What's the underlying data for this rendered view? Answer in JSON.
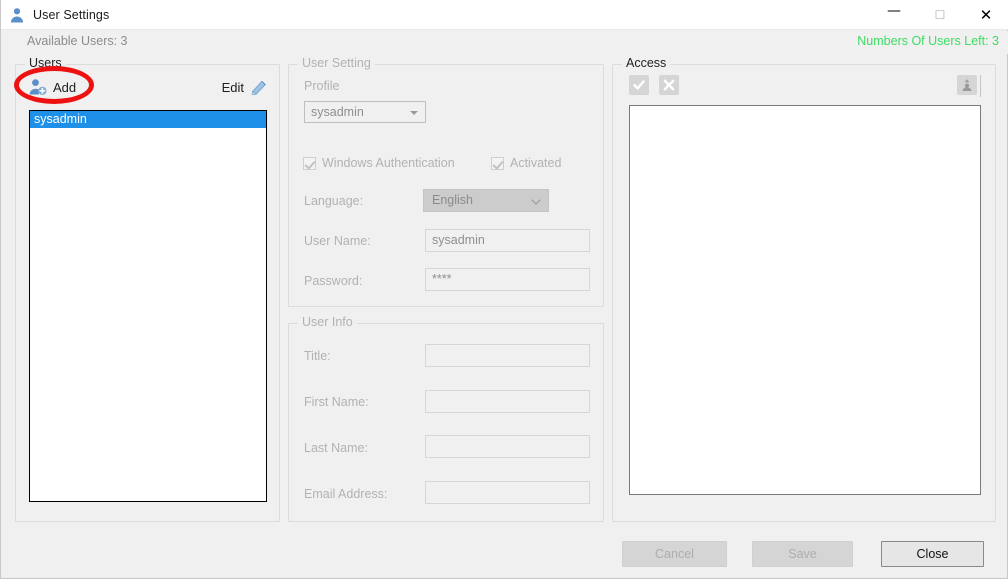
{
  "window": {
    "title": "User Settings",
    "icon": "user-icon",
    "controls": {
      "minimize": "—",
      "maximize": "☐",
      "close": "✕"
    }
  },
  "status": {
    "available_users": "Available Users: 3",
    "users_left": "Numbers Of Users Left: 3",
    "users_left_color": "#3ddc62"
  },
  "users_panel": {
    "title": "Users",
    "add_label": "Add",
    "add_icon": "add-user-icon",
    "edit_label": "Edit",
    "edit_icon": "edit-pencil-icon",
    "list": [
      {
        "label": "sysadmin",
        "selected": true
      }
    ],
    "selection_color": "#1e90e8",
    "annotation": "red-ellipse-highlight"
  },
  "user_setting": {
    "title": "User Setting",
    "profile_label": "Profile",
    "profile_value": "sysadmin",
    "windows_auth_label": "Windows Authentication",
    "windows_auth_checked": true,
    "activated_label": "Activated",
    "activated_checked": true,
    "language_label": "Language:",
    "language_value": "English",
    "username_label": "User Name:",
    "username_value": "sysadmin",
    "password_label": "Password:",
    "password_value": "****"
  },
  "user_info": {
    "title": "User Info",
    "title_label": "Title:",
    "title_value": "",
    "first_name_label": "First Name:",
    "first_name_value": "",
    "last_name_label": "Last Name:",
    "last_name_value": "",
    "email_label": "Email Address:",
    "email_value": ""
  },
  "access": {
    "title": "Access",
    "check_all_icon": "check-all-icon",
    "clear_all_icon": "clear-all-x-icon",
    "export_icon": "export-user-icon",
    "items": []
  },
  "footer": {
    "cancel_label": "Cancel",
    "cancel_enabled": false,
    "save_label": "Save",
    "save_enabled": false,
    "close_label": "Close",
    "close_enabled": true
  }
}
